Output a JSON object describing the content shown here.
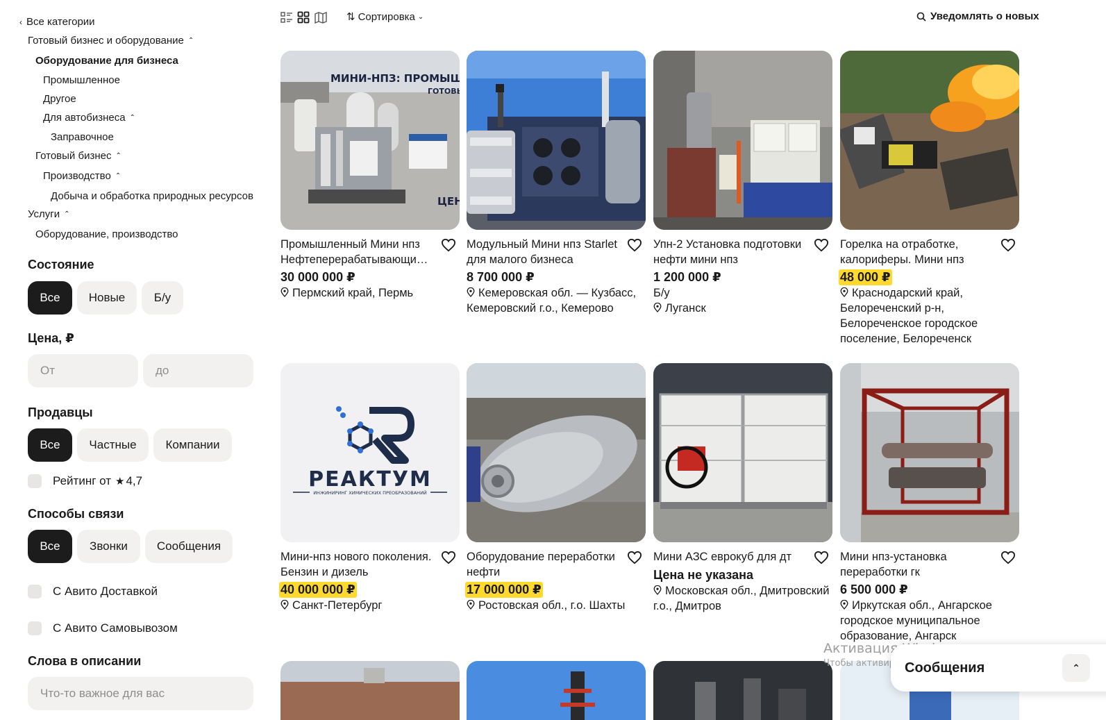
{
  "sidebar": {
    "all_categories": "Все категории",
    "categories": [
      {
        "label": "Готовый бизнес и оборудование",
        "chevron": true
      },
      {
        "label": "Оборудование для бизнеса",
        "chevron": false
      },
      {
        "label": "Промышленное",
        "chevron": false
      },
      {
        "label": "Другое",
        "chevron": false
      },
      {
        "label": "Для автобизнеса",
        "chevron": true
      },
      {
        "label": "Заправочное",
        "chevron": false
      },
      {
        "label": "Готовый бизнес",
        "chevron": true
      },
      {
        "label": "Производство",
        "chevron": true
      },
      {
        "label": "Добыча и обработка природных ресурсов",
        "chevron": false
      },
      {
        "label": "Услуги",
        "chevron": true
      },
      {
        "label": "Оборудование, производство",
        "chevron": false
      }
    ],
    "condition": {
      "title": "Состояние",
      "options": [
        "Все",
        "Новые",
        "Б/у"
      ],
      "selected": "Все"
    },
    "price": {
      "title": "Цена, ₽",
      "from_placeholder": "От",
      "to_placeholder": "до",
      "from_value": "",
      "to_value": ""
    },
    "sellers": {
      "title": "Продавцы",
      "options": [
        "Все",
        "Частные",
        "Компании"
      ],
      "selected": "Все"
    },
    "rating": {
      "label": "Рейтинг от",
      "star": "★",
      "value": "4,7",
      "checked": false
    },
    "contact": {
      "title": "Способы связи",
      "options": [
        "Все",
        "Звонки",
        "Сообщения"
      ],
      "selected": "Все"
    },
    "delivery": {
      "label": "С Авито Доставкой",
      "checked": false
    },
    "pickup": {
      "label": "С Авито Самовывозом",
      "checked": false
    },
    "keywords": {
      "title": "Слова в описании",
      "placeholder": "Что-то важное для вас",
      "value": ""
    }
  },
  "toolbar": {
    "view_icons": [
      "list-view-icon",
      "grid-view-icon",
      "map-view-icon"
    ],
    "sort_label": "Сортировка",
    "notify_label": "Уведомлять о новых"
  },
  "listings": [
    {
      "title": "Промышленный Мини нпз Нефтеперерабатывающий завод",
      "price": "30 000 000 ₽",
      "highlight": false,
      "condition": "",
      "location": "Пермский край, Пермь",
      "image": "mini-refinery-photo",
      "image_texts": [
        "МИНИ-НПЗ: ПРОМЫШЛЕНН",
        "ГОТОВЫЙ",
        "ЦЕН"
      ]
    },
    {
      "title": "Модульный Мини нпз Starlet для малого бизнеса",
      "price": "8 700 000 ₽",
      "highlight": false,
      "condition": "",
      "location": "Кемеровская обл. — Кузбасс, Кемеровский г.о., Кемерово",
      "image": "modular-unit-photo",
      "image_texts": []
    },
    {
      "title": "Упн-2 Установка подготовки нефти мини нпз",
      "price": "1 200 000 ₽",
      "highlight": false,
      "condition": "Б/у",
      "location": "Луганск",
      "image": "oil-prep-unit-photo",
      "image_texts": []
    },
    {
      "title": "Горелка на отработке, калориферы. Мини нпз",
      "price": "48 000 ₽",
      "highlight": true,
      "condition": "",
      "location": "Краснодарский край, Белореченский р-н, Белореченское городское поселение, Белореченск",
      "image": "burner-flame-photo",
      "image_texts": []
    },
    {
      "title": "Мини-нпз нового поколения. Бензин и дизель",
      "price": "40 000 000 ₽",
      "highlight": true,
      "condition": "",
      "location": "Санкт-Петербург",
      "image": "reaktum-logo",
      "image_texts": [
        "РЕАКТУМ",
        "ИНЖИНИРИНГ ХИМИЧЕСКИХ ПРЕОБРАЗОВАНИЙ"
      ]
    },
    {
      "title": "Оборудование переработки нефти",
      "price": "17 000 000 ₽",
      "highlight": true,
      "condition": "",
      "location": "Ростовская обл., г.о. Шахты",
      "image": "steel-tank-photo",
      "image_texts": []
    },
    {
      "title": "Мини АЗС еврокуб для дт",
      "price": "Цена не указана",
      "highlight": false,
      "condition": "",
      "location": "Московская обл., Дмитровский г.о., Дмитров",
      "image": "eurocube-fuel-station-photo",
      "image_texts": []
    },
    {
      "title": "Мини нпз-установка переработки гк",
      "price": "6 500 000 ₽",
      "highlight": false,
      "condition": "",
      "location": "Иркутская обл., Ангарское городское муниципальное образование, Ангарск",
      "image": "red-frame-unit-photo",
      "image_texts": []
    }
  ],
  "windows_activation": {
    "line1": "Активация Windows",
    "line2": "Чтобы активировать Windows, перейдите в раздел \"Параметры\""
  },
  "messages_panel": {
    "label": "Сообщения"
  },
  "colors": {
    "accent_dark": "#1c1c1c",
    "pill_bg": "#f2f1f0",
    "price_highlight": "#ffd92e"
  }
}
